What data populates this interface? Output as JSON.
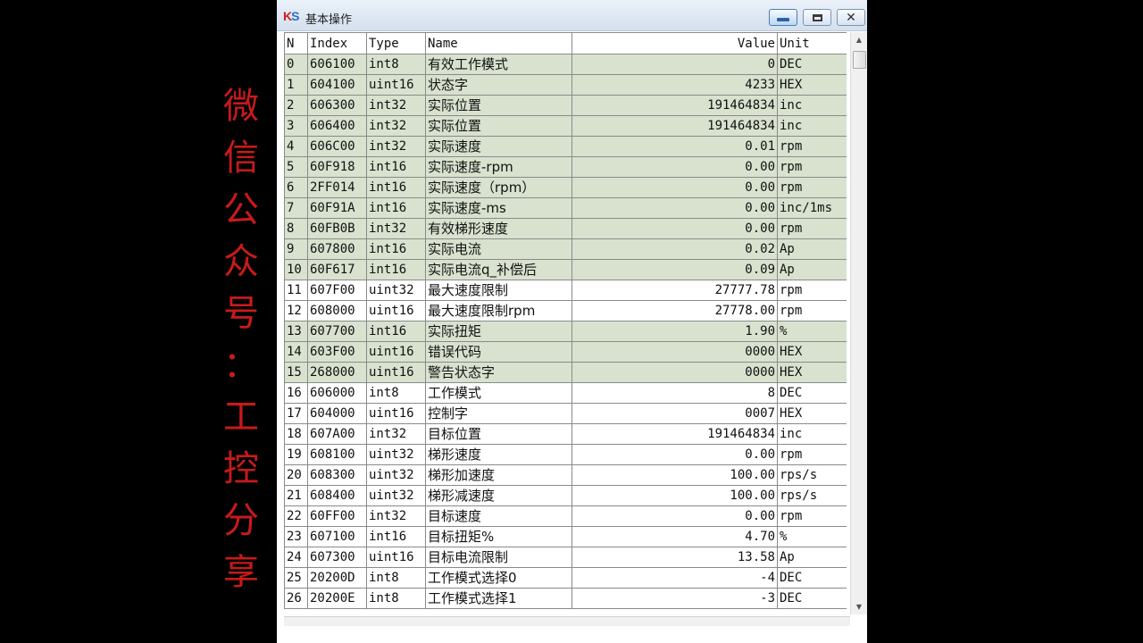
{
  "watermark": [
    "微",
    "信",
    "公",
    "众",
    "号",
    "：",
    "工",
    "控",
    "分",
    "享"
  ],
  "window": {
    "logo_main": "K",
    "logo_accent": "S",
    "title": "基本操作",
    "buttons": {
      "minimize": "minimize-icon",
      "maximize": "maximize-icon",
      "close": "close-icon"
    }
  },
  "colors": {
    "highlight_row": "#d8e2cf",
    "watermark": "#c81a1a"
  },
  "table": {
    "headers": [
      "N",
      "Index",
      "Type",
      "Name",
      "Value",
      "Unit"
    ],
    "rows": [
      {
        "n": "0",
        "index": "606100",
        "type": "int8",
        "name": "有效工作模式",
        "value": "0",
        "unit": "DEC",
        "hl": true
      },
      {
        "n": "1",
        "index": "604100",
        "type": "uint16",
        "name": "状态字",
        "value": "4233",
        "unit": "HEX",
        "hl": true
      },
      {
        "n": "2",
        "index": "606300",
        "type": "int32",
        "name": "实际位置",
        "value": "191464834",
        "unit": "inc",
        "hl": true
      },
      {
        "n": "3",
        "index": "606400",
        "type": "int32",
        "name": "实际位置",
        "value": "191464834",
        "unit": "inc",
        "hl": true
      },
      {
        "n": "4",
        "index": "606C00",
        "type": "int32",
        "name": "实际速度",
        "value": "0.01",
        "unit": "rpm",
        "hl": true
      },
      {
        "n": "5",
        "index": "60F918",
        "type": "int16",
        "name": "实际速度-rpm",
        "value": "0.00",
        "unit": "rpm",
        "hl": true
      },
      {
        "n": "6",
        "index": "2FF014",
        "type": "int16",
        "name": "实际速度（rpm）",
        "value": "0.00",
        "unit": "rpm",
        "hl": true
      },
      {
        "n": "7",
        "index": "60F91A",
        "type": "int16",
        "name": "实际速度-ms",
        "value": "0.00",
        "unit": "inc/1ms",
        "hl": true
      },
      {
        "n": "8",
        "index": "60FB0B",
        "type": "int32",
        "name": "有效梯形速度",
        "value": "0.00",
        "unit": "rpm",
        "hl": true
      },
      {
        "n": "9",
        "index": "607800",
        "type": "int16",
        "name": "实际电流",
        "value": "0.02",
        "unit": "Ap",
        "hl": true
      },
      {
        "n": "10",
        "index": "60F617",
        "type": "int16",
        "name": "实际电流q_补偿后",
        "value": "0.09",
        "unit": "Ap",
        "hl": true
      },
      {
        "n": "11",
        "index": "607F00",
        "type": "uint32",
        "name": "最大速度限制",
        "value": "27777.78",
        "unit": "rpm",
        "hl": false
      },
      {
        "n": "12",
        "index": "608000",
        "type": "uint16",
        "name": "最大速度限制rpm",
        "value": "27778.00",
        "unit": "rpm",
        "hl": false
      },
      {
        "n": "13",
        "index": "607700",
        "type": "int16",
        "name": "实际扭矩",
        "value": "1.90",
        "unit": "%",
        "hl": true
      },
      {
        "n": "14",
        "index": "603F00",
        "type": "uint16",
        "name": "错误代码",
        "value": "0000",
        "unit": "HEX",
        "hl": true
      },
      {
        "n": "15",
        "index": "268000",
        "type": "uint16",
        "name": "警告状态字",
        "value": "0000",
        "unit": "HEX",
        "hl": true
      },
      {
        "n": "16",
        "index": "606000",
        "type": "int8",
        "name": "工作模式",
        "value": "8",
        "unit": "DEC",
        "hl": false
      },
      {
        "n": "17",
        "index": "604000",
        "type": "uint16",
        "name": "控制字",
        "value": "0007",
        "unit": "HEX",
        "hl": false
      },
      {
        "n": "18",
        "index": "607A00",
        "type": "int32",
        "name": "目标位置",
        "value": "191464834",
        "unit": "inc",
        "hl": false
      },
      {
        "n": "19",
        "index": "608100",
        "type": "uint32",
        "name": "梯形速度",
        "value": "0.00",
        "unit": "rpm",
        "hl": false
      },
      {
        "n": "20",
        "index": "608300",
        "type": "uint32",
        "name": "梯形加速度",
        "value": "100.00",
        "unit": "rps/s",
        "hl": false
      },
      {
        "n": "21",
        "index": "608400",
        "type": "uint32",
        "name": "梯形减速度",
        "value": "100.00",
        "unit": "rps/s",
        "hl": false
      },
      {
        "n": "22",
        "index": "60FF00",
        "type": "int32",
        "name": "目标速度",
        "value": "0.00",
        "unit": "rpm",
        "hl": false
      },
      {
        "n": "23",
        "index": "607100",
        "type": "int16",
        "name": "目标扭矩%",
        "value": "4.70",
        "unit": "%",
        "hl": false
      },
      {
        "n": "24",
        "index": "607300",
        "type": "uint16",
        "name": "目标电流限制",
        "value": "13.58",
        "unit": "Ap",
        "hl": false
      },
      {
        "n": "25",
        "index": "20200D",
        "type": "int8",
        "name": "工作模式选择0",
        "value": "-4",
        "unit": "DEC",
        "hl": false
      },
      {
        "n": "26",
        "index": "20200E",
        "type": "int8",
        "name": "工作模式选择1",
        "value": "-3",
        "unit": "DEC",
        "hl": false
      }
    ]
  }
}
